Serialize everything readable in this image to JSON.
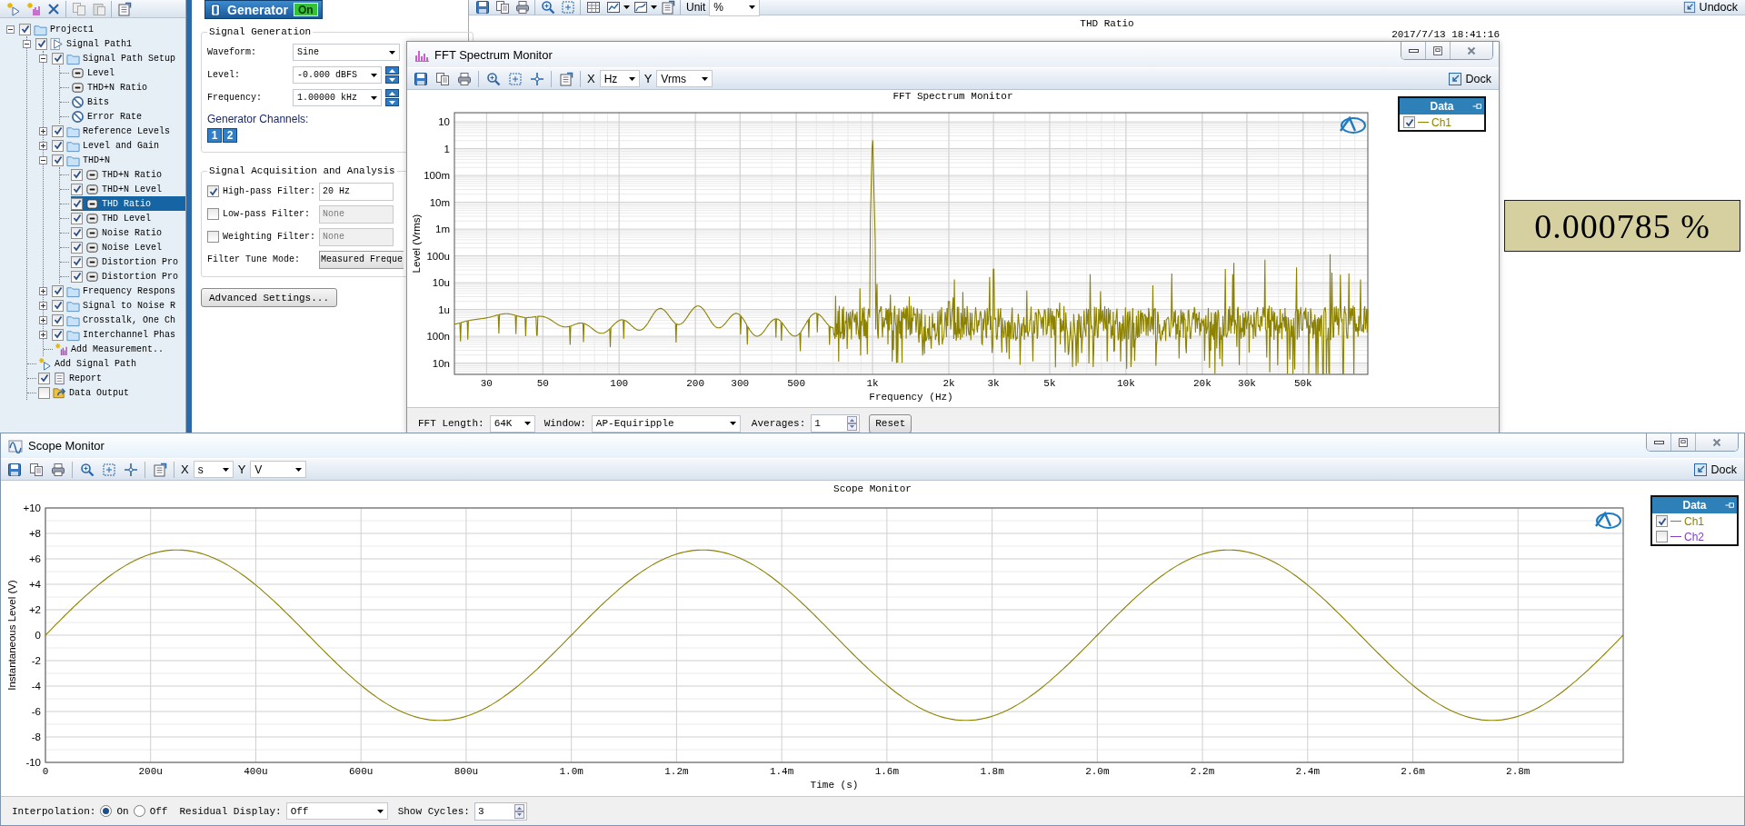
{
  "tree": {
    "items": [
      {
        "label": "Project1",
        "kind": "folder",
        "selected": false,
        "checked": true,
        "expanded": true,
        "children": [
          {
            "label": "Signal Path1",
            "kind": "path",
            "selected": false,
            "checked": true,
            "expanded": true,
            "children": [
              {
                "label": "Signal Path Setup",
                "kind": "folder",
                "selected": false,
                "checked": true,
                "expanded": true,
                "children": [
                  {
                    "label": "Level",
                    "kind": "meter",
                    "selected": false
                  },
                  {
                    "label": "THD+N Ratio",
                    "kind": "meter",
                    "selected": false
                  },
                  {
                    "label": "Bits",
                    "kind": "blocked",
                    "selected": false
                  },
                  {
                    "label": "Error Rate",
                    "kind": "blocked",
                    "selected": false
                  }
                ]
              },
              {
                "label": "Reference Levels",
                "kind": "folder",
                "selected": false,
                "checked": true,
                "expanded": false
              },
              {
                "label": "Level and Gain",
                "kind": "folder",
                "selected": false,
                "checked": true,
                "expanded": false
              },
              {
                "label": "THD+N",
                "kind": "folder",
                "selected": false,
                "checked": true,
                "expanded": true,
                "children": [
                  {
                    "label": "THD+N Ratio",
                    "kind": "meter",
                    "selected": false,
                    "checked": true
                  },
                  {
                    "label": "THD+N Level",
                    "kind": "meter",
                    "selected": false,
                    "checked": true
                  },
                  {
                    "label": "THD Ratio",
                    "kind": "meter",
                    "selected": true,
                    "checked": true
                  },
                  {
                    "label": "THD Level",
                    "kind": "meter",
                    "selected": false,
                    "checked": true
                  },
                  {
                    "label": "Noise Ratio",
                    "kind": "meter",
                    "selected": false,
                    "checked": true
                  },
                  {
                    "label": "Noise Level",
                    "kind": "meter",
                    "selected": false,
                    "checked": true
                  },
                  {
                    "label": "Distortion Pro",
                    "kind": "meter",
                    "selected": false,
                    "checked": true
                  },
                  {
                    "label": "Distortion Pro",
                    "kind": "meter",
                    "selected": false,
                    "checked": true
                  }
                ]
              },
              {
                "label": "Frequency Respons",
                "kind": "folder",
                "selected": false,
                "checked": true,
                "expanded": false
              },
              {
                "label": "Signal to Noise R",
                "kind": "folder",
                "selected": false,
                "checked": true,
                "expanded": false
              },
              {
                "label": "Crosstalk, One Ch",
                "kind": "folder",
                "selected": false,
                "checked": true,
                "expanded": false
              },
              {
                "label": "Interchannel Phas",
                "kind": "folder",
                "selected": false,
                "checked": true,
                "expanded": false
              },
              {
                "label": "Add Measurement..",
                "kind": "add-measurement",
                "selected": false
              }
            ]
          },
          {
            "label": "Add Signal Path",
            "kind": "add-path",
            "selected": false
          },
          {
            "label": "Report",
            "kind": "report",
            "selected": false,
            "checked": true
          },
          {
            "label": "Data Output",
            "kind": "output",
            "selected": false,
            "checked": false
          }
        ]
      }
    ]
  },
  "generator": {
    "title": "Generator",
    "on_label": "On",
    "on": true,
    "signal_generation": {
      "title": "Signal Generation",
      "fields": [
        {
          "label": "Waveform:",
          "value": "Sine",
          "kind": "dropdown"
        },
        {
          "label": "Level:",
          "value": "-0.000 dBFS",
          "kind": "spin-dropdown"
        },
        {
          "label": "Frequency:",
          "value": "1.00000 kHz",
          "kind": "spin-dropdown"
        }
      ],
      "channels_label": "Generator Channels:",
      "channels": [
        {
          "label": "1",
          "selected": true
        },
        {
          "label": "2",
          "selected": true
        }
      ]
    },
    "acquisition": {
      "title": "Signal Acquisition and Analysis",
      "fields": [
        {
          "label": "High-pass Filter:",
          "kind": "check-field",
          "checked": true,
          "disabled": false,
          "value": "20 Hz"
        },
        {
          "label": "Low-pass Filter:",
          "kind": "check-field",
          "checked": false,
          "disabled": true,
          "value": "None"
        },
        {
          "label": "Weighting Filter:",
          "kind": "check-field",
          "checked": false,
          "disabled": true,
          "value": "None"
        },
        {
          "label": "Filter Tune Mode:",
          "kind": "button-field",
          "value": "Measured Freque"
        }
      ]
    },
    "advanced_button": "Advanced Settings..."
  },
  "meter_panel": {
    "unit_label": "Unit",
    "unit": "%",
    "undock": "Undock",
    "title": "THD Ratio",
    "timestamp": "2017/7/13 18:41:16",
    "reading": "0.000785 %"
  },
  "fft_window": {
    "title": "FFT Spectrum Monitor",
    "x_label": "X",
    "x_unit": "Hz",
    "y_label": "Y",
    "y_unit": "Vrms",
    "dock": "Dock",
    "chart": {
      "title": "FFT Spectrum Monitor",
      "xlabel": "Frequency (Hz)",
      "ylabel": "Level (Vrms)",
      "x_tick_labels": [
        "30",
        "50",
        "100",
        "200",
        "300",
        "500",
        "1k",
        "2k",
        "3k",
        "5k",
        "10k",
        "20k",
        "30k",
        "50k"
      ],
      "y_tick_labels": [
        "10",
        "1",
        "100m",
        "10m",
        "1m",
        "100u",
        "10u",
        "1u",
        "100n",
        "10n"
      ]
    },
    "legend": {
      "title": "Data",
      "items": [
        {
          "label": "Ch1",
          "checked": true,
          "color": "#8c8200"
        }
      ]
    },
    "footer": {
      "fft_length_label": "FFT Length:",
      "fft_length": "64K",
      "window_label": "Window:",
      "window": "AP-Equiripple",
      "averages_label": "Averages:",
      "averages": "1",
      "reset": "Reset"
    }
  },
  "scope_window": {
    "title": "Scope Monitor",
    "x_label": "X",
    "x_unit": "s",
    "y_label": "Y",
    "y_unit": "V",
    "dock": "Dock",
    "chart": {
      "title": "Scope Monitor",
      "xlabel": "Time (s)",
      "ylabel": "Instantaneous Level (V)",
      "x_tick_labels": [
        "0",
        "200u",
        "400u",
        "600u",
        "800u",
        "1.0m",
        "1.2m",
        "1.4m",
        "1.6m",
        "1.8m",
        "2.0m",
        "2.2m",
        "2.4m",
        "2.6m",
        "2.8m"
      ],
      "y_tick_labels": [
        "+10",
        "+8",
        "+6",
        "+4",
        "+2",
        "0",
        "-2",
        "-4",
        "-6",
        "-8",
        "-10"
      ]
    },
    "legend": {
      "title": "Data",
      "items": [
        {
          "label": "Ch1",
          "checked": true,
          "color": "#8c8200"
        },
        {
          "label": "Ch2",
          "checked": false,
          "color": "#8040c0"
        }
      ]
    },
    "footer": {
      "interpolation_label": "Interpolation:",
      "interpolation": [
        {
          "label": "On",
          "selected": true
        },
        {
          "label": "Off",
          "selected": false
        }
      ],
      "residual_label": "Residual Display:",
      "residual": "Off",
      "cycles_label": "Show Cycles:",
      "cycles": "3"
    }
  }
}
